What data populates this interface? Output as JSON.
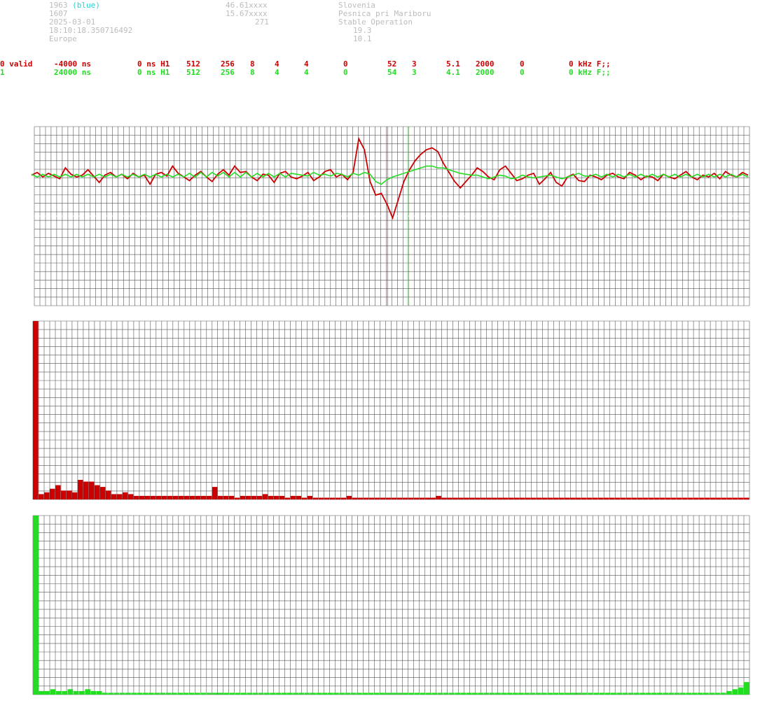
{
  "station": {
    "id": "1963",
    "color_tag": "(blue)",
    "line2": "1607",
    "date": "2025-03-01",
    "time": "18:10:18.350716492",
    "region": "Europe",
    "lat": "46.61xxxx",
    "lon": "15.67xxxx",
    "alt": "271",
    "country": "Slovenia",
    "place": "Pesnica pri Mariboru",
    "status": "Stable Operation",
    "value1": "19.3",
    "value2": "10.1"
  },
  "channels": [
    {
      "col0": "0 valid",
      "col1": "-4000 ns",
      "col2": "0 ns H1",
      "col3": "512",
      "col4": "256",
      "col5": "8",
      "col6": "4",
      "col7": "4",
      "col8": "0",
      "col9": "52",
      "col10": "3",
      "col11": "5.1",
      "col12": "2000",
      "col13": "0",
      "col14": "0 kHz F;;"
    },
    {
      "col0": "1",
      "col1": "24000 ns",
      "col2": "0 ns H1",
      "col3": "512",
      "col4": "256",
      "col5": "8",
      "col6": "4",
      "col7": "4",
      "col8": "0",
      "col9": "54",
      "col10": "3",
      "col11": "4.1",
      "col12": "2000",
      "col13": "0",
      "col14": "0 kHz F;;"
    }
  ],
  "colors": {
    "red": "#cc0000",
    "green": "#22dd22",
    "grid": "#555555",
    "grey_text": "#bcbcbc",
    "cyan": "#1ad6d6"
  },
  "chart_data": [
    {
      "type": "line",
      "name": "waveform",
      "x_count": 128,
      "ylim": [
        -1,
        1
      ],
      "markers": [
        0.494,
        0.522
      ],
      "series": [
        {
          "name": "0",
          "values": [
            0.02,
            0.05,
            0.0,
            0.04,
            0.01,
            -0.02,
            0.1,
            0.03,
            0.0,
            0.02,
            0.08,
            0.01,
            -0.06,
            0.02,
            0.05,
            0.0,
            0.03,
            -0.02,
            0.04,
            0.0,
            0.02,
            -0.08,
            0.03,
            0.05,
            0.01,
            0.12,
            0.04,
            0.0,
            -0.04,
            0.02,
            0.06,
            0.0,
            -0.05,
            0.03,
            0.08,
            0.02,
            0.12,
            0.05,
            0.06,
            0.0,
            -0.04,
            0.03,
            0.02,
            -0.06,
            0.04,
            0.06,
            0.0,
            -0.02,
            0.01,
            0.05,
            -0.04,
            0.0,
            0.06,
            0.08,
            0.0,
            0.03,
            -0.03,
            0.05,
            0.42,
            0.3,
            -0.05,
            -0.2,
            -0.18,
            -0.3,
            -0.45,
            -0.25,
            -0.05,
            0.08,
            0.18,
            0.25,
            0.3,
            0.32,
            0.28,
            0.15,
            0.05,
            -0.05,
            -0.12,
            -0.05,
            0.02,
            0.1,
            0.06,
            0.0,
            -0.03,
            0.08,
            0.12,
            0.04,
            -0.04,
            -0.02,
            0.02,
            0.04,
            -0.08,
            -0.02,
            0.05,
            -0.06,
            -0.1,
            0.0,
            0.03,
            -0.04,
            -0.05,
            0.02,
            0.0,
            -0.03,
            0.02,
            0.04,
            0.0,
            -0.02,
            0.05,
            0.02,
            -0.03,
            0.01,
            0.0,
            -0.04,
            0.03,
            0.0,
            -0.02,
            0.02,
            0.06,
            0.0,
            -0.03,
            0.02,
            0.0,
            0.04,
            -0.02,
            0.06,
            0.02,
            0.0,
            0.05,
            0.02
          ]
        },
        {
          "name": "1",
          "values": [
            0.03,
            0.0,
            0.03,
            0.0,
            0.03,
            0.0,
            0.03,
            0.0,
            0.03,
            0.0,
            0.03,
            0.0,
            0.03,
            0.0,
            0.03,
            0.0,
            0.03,
            0.0,
            0.03,
            0.0,
            0.03,
            0.0,
            0.03,
            0.0,
            0.03,
            0.0,
            0.03,
            0.0,
            0.04,
            0.0,
            0.05,
            0.0,
            0.05,
            0.01,
            0.05,
            0.0,
            0.05,
            0.0,
            0.05,
            0.0,
            0.04,
            0.0,
            0.04,
            0.0,
            0.04,
            0.0,
            0.04,
            0.03,
            0.02,
            0.01,
            0.05,
            0.02,
            0.03,
            0.01,
            0.04,
            0.03,
            0.0,
            0.04,
            0.02,
            0.05,
            0.03,
            -0.05,
            -0.08,
            -0.03,
            0.0,
            0.02,
            0.04,
            0.06,
            0.08,
            0.1,
            0.12,
            0.12,
            0.1,
            0.1,
            0.08,
            0.06,
            0.04,
            0.03,
            0.02,
            0.02,
            0.0,
            -0.02,
            0.0,
            0.02,
            0.01,
            -0.02,
            -0.01,
            0.02,
            0.0,
            -0.01,
            0.0,
            0.01,
            0.02,
            0.0,
            -0.02,
            0.0,
            0.02,
            0.04,
            0.01,
            0.01,
            0.03,
            0.0,
            0.03,
            0.0,
            0.03,
            0.0,
            0.03,
            0.0,
            0.03,
            0.0,
            0.03,
            0.0,
            0.03,
            0.0,
            0.03,
            0.0,
            0.03,
            0.0,
            0.03,
            0.0,
            0.03,
            0.0,
            0.03,
            0.0,
            0.03,
            0.0,
            0.03,
            0.0
          ]
        }
      ]
    },
    {
      "type": "bar",
      "name": "spectrum-0",
      "ylim": [
        0,
        1
      ],
      "values": [
        1.0,
        0.03,
        0.04,
        0.06,
        0.08,
        0.05,
        0.05,
        0.04,
        0.11,
        0.1,
        0.1,
        0.08,
        0.07,
        0.05,
        0.03,
        0.03,
        0.04,
        0.03,
        0.02,
        0.02,
        0.02,
        0.02,
        0.02,
        0.02,
        0.02,
        0.02,
        0.02,
        0.02,
        0.02,
        0.02,
        0.02,
        0.02,
        0.07,
        0.02,
        0.02,
        0.02,
        0.01,
        0.02,
        0.02,
        0.02,
        0.02,
        0.03,
        0.02,
        0.02,
        0.02,
        0.01,
        0.02,
        0.02,
        0.01,
        0.02,
        0.01,
        0.01,
        0.01,
        0.01,
        0.01,
        0.01,
        0.02,
        0.01,
        0.01,
        0.01,
        0.01,
        0.01,
        0.01,
        0.01,
        0.01,
        0.01,
        0.01,
        0.01,
        0.01,
        0.01,
        0.01,
        0.01,
        0.02,
        0.01,
        0.01,
        0.01,
        0.01,
        0.01,
        0.01,
        0.01,
        0.01,
        0.01,
        0.01,
        0.01,
        0.01,
        0.01,
        0.01,
        0.01,
        0.01,
        0.01,
        0.01,
        0.01,
        0.01,
        0.01,
        0.01,
        0.01,
        0.01,
        0.01,
        0.01,
        0.01,
        0.01,
        0.01,
        0.01,
        0.01,
        0.01,
        0.01,
        0.01,
        0.01,
        0.01,
        0.01,
        0.01,
        0.01,
        0.01,
        0.01,
        0.01,
        0.01,
        0.01,
        0.01,
        0.01,
        0.01,
        0.01,
        0.01,
        0.01,
        0.01,
        0.01,
        0.01,
        0.01,
        0.01
      ]
    },
    {
      "type": "bar",
      "name": "spectrum-1",
      "ylim": [
        0,
        1
      ],
      "values": [
        1.0,
        0.02,
        0.02,
        0.03,
        0.02,
        0.02,
        0.03,
        0.02,
        0.02,
        0.03,
        0.02,
        0.02,
        0.01,
        0.01,
        0.01,
        0.01,
        0.01,
        0.01,
        0.01,
        0.01,
        0.01,
        0.01,
        0.01,
        0.01,
        0.01,
        0.01,
        0.01,
        0.01,
        0.01,
        0.01,
        0.01,
        0.01,
        0.01,
        0.01,
        0.01,
        0.01,
        0.01,
        0.01,
        0.01,
        0.01,
        0.01,
        0.01,
        0.01,
        0.01,
        0.01,
        0.01,
        0.01,
        0.01,
        0.01,
        0.01,
        0.01,
        0.01,
        0.01,
        0.01,
        0.01,
        0.01,
        0.01,
        0.01,
        0.01,
        0.01,
        0.01,
        0.01,
        0.01,
        0.01,
        0.01,
        0.01,
        0.01,
        0.01,
        0.01,
        0.01,
        0.01,
        0.01,
        0.01,
        0.01,
        0.01,
        0.01,
        0.01,
        0.01,
        0.01,
        0.01,
        0.01,
        0.01,
        0.01,
        0.01,
        0.01,
        0.01,
        0.01,
        0.01,
        0.01,
        0.01,
        0.01,
        0.01,
        0.01,
        0.01,
        0.01,
        0.01,
        0.01,
        0.01,
        0.01,
        0.01,
        0.01,
        0.01,
        0.01,
        0.01,
        0.01,
        0.01,
        0.01,
        0.01,
        0.01,
        0.01,
        0.01,
        0.01,
        0.01,
        0.01,
        0.01,
        0.01,
        0.01,
        0.01,
        0.01,
        0.01,
        0.02,
        0.03,
        0.04,
        0.07
      ]
    }
  ]
}
